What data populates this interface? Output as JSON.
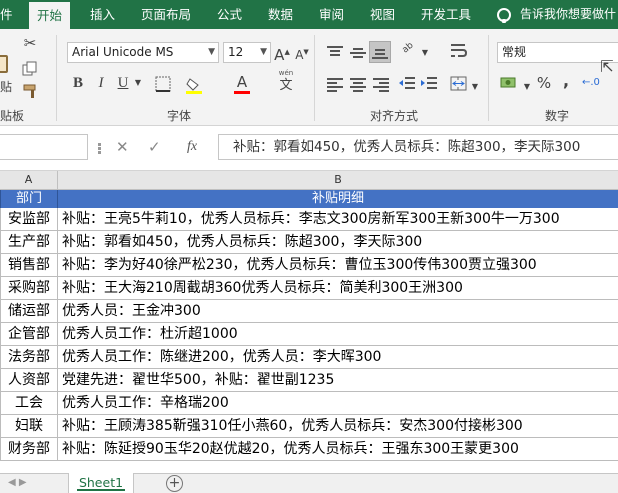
{
  "ribbon": {
    "tabs": [
      "件",
      "开始",
      "插入",
      "页面布局",
      "公式",
      "数据",
      "审阅",
      "视图",
      "开发工具"
    ],
    "tell_me": "告诉我你想要做什",
    "clipboard": {
      "label": "贴板",
      "paste_label": "贴"
    },
    "font": {
      "label": "字体",
      "name": "Arial Unicode MS",
      "size": "12",
      "bold": "B",
      "italic": "I",
      "underline": "U",
      "grow": "A",
      "shrink": "A",
      "color_letter": "A",
      "wen": "wén",
      "wen_char": "文"
    },
    "alignment": {
      "label": "对齐方式",
      "wrap_ab": "ab"
    },
    "number": {
      "label": "数字",
      "format": "常规",
      "percent": "%",
      "comma": ","
    },
    "font_color": "#ff0000"
  },
  "formula_bar": {
    "cancel": "✕",
    "enter": "✓",
    "fx": "fx",
    "content": "补贴：郭看如450，优秀人员标兵：陈超300，李天际300"
  },
  "columns": [
    "A",
    "B"
  ],
  "table": {
    "header": [
      "部门",
      "补贴明细"
    ],
    "rows": [
      [
        "安监部",
        "补贴：王亮5牛莉10，优秀人员标兵：李志文300房新军300王新300牛一万300"
      ],
      [
        "生产部",
        "补贴：郭看如450，优秀人员标兵：陈超300，李天际300"
      ],
      [
        "销售部",
        "补贴：李为好40徐严松230，优秀人员标兵：曹位玉300传伟300贾立强300"
      ],
      [
        "采购部",
        "补贴：王大海210周截胡360优秀人员标兵：简美利300王洲300"
      ],
      [
        "储运部",
        "优秀人员：王金冲300"
      ],
      [
        "企管部",
        "优秀人员工作：杜沂超1000"
      ],
      [
        "法务部",
        "优秀人员工作：陈继进200，优秀人员：李大晖300"
      ],
      [
        "人资部",
        "党建先进：翟世华500，补贴：翟世副1235"
      ],
      [
        "工会",
        "优秀人员工作：辛格瑞200"
      ],
      [
        "妇联",
        "补贴：王顾涛385靳强310任小燕60，优秀人员标兵：安杰300付接彬300"
      ],
      [
        "财务部",
        "补贴：陈延授90玉华20赵优越20，优秀人员标兵：王强东300王蒙更300"
      ]
    ]
  },
  "sheets": {
    "active": "Sheet1",
    "add": "+",
    "nav": "◀ ▶"
  }
}
